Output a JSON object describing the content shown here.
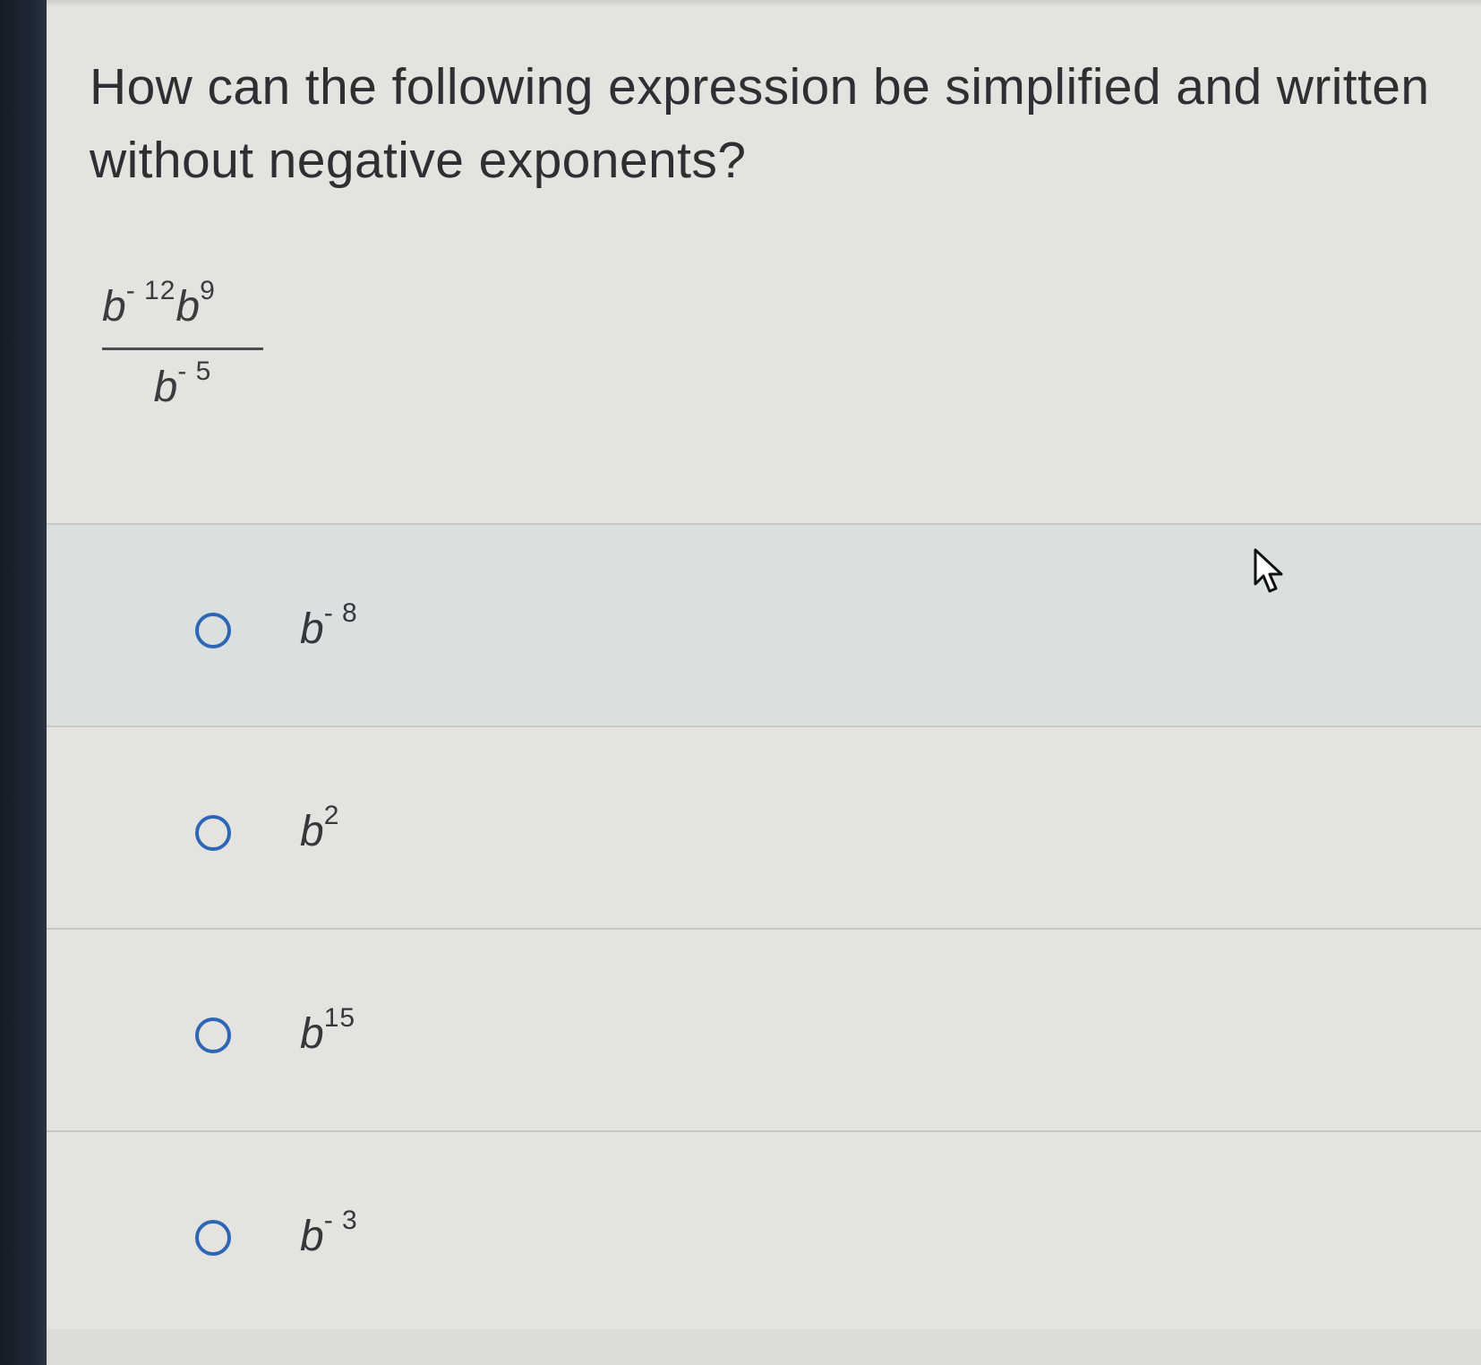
{
  "question": {
    "text": "How can the following expression be simplified and written without negative exponents?"
  },
  "expression": {
    "numerator": [
      {
        "base": "b",
        "exponent": "- 12"
      },
      {
        "base": "b",
        "exponent": "9"
      }
    ],
    "denominator": {
      "base": "b",
      "exponent": "- 5"
    }
  },
  "options": [
    {
      "base": "b",
      "exponent": "- 8",
      "selected": false
    },
    {
      "base": "b",
      "exponent": "2",
      "selected": false
    },
    {
      "base": "b",
      "exponent": "15",
      "selected": false
    },
    {
      "base": "b",
      "exponent": "- 3",
      "selected": false
    }
  ],
  "colors": {
    "radio_border": "#2e66b6",
    "background": "#e4e3df",
    "text": "#2d2f33"
  },
  "icons": {
    "cursor": "mouse-pointer-arrow-icon"
  }
}
